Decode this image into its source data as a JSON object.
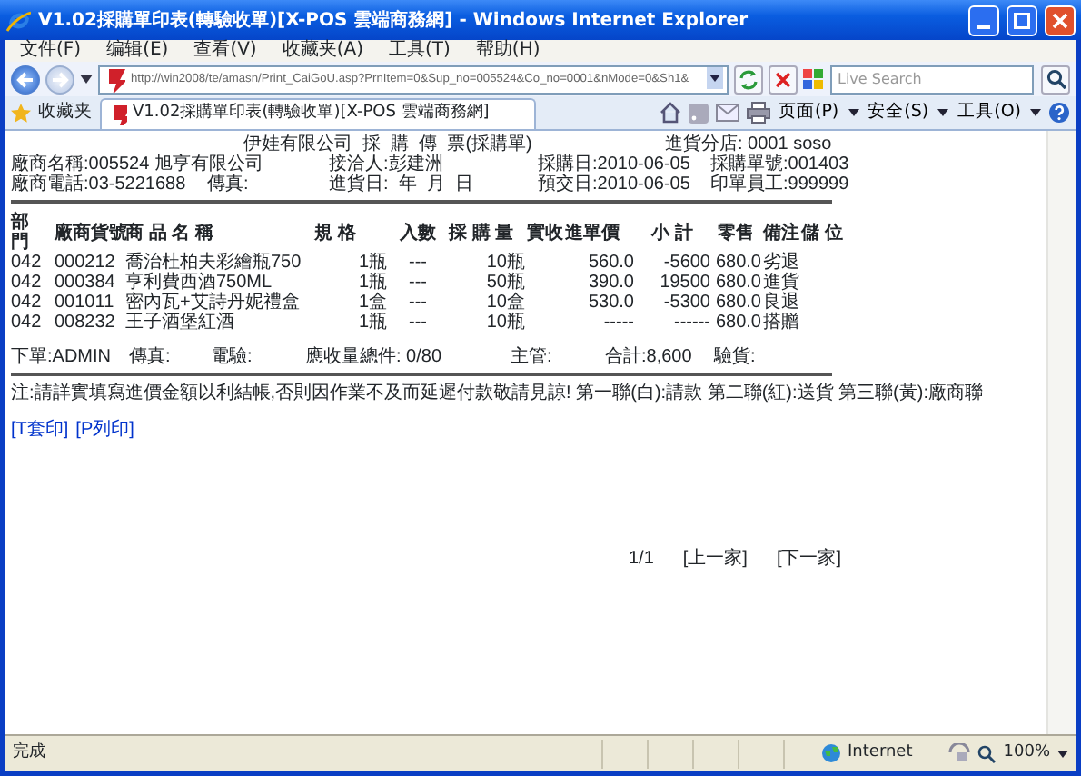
{
  "window": {
    "title": "V1.02採購單印表(轉驗收單)[X-POS 雲端商務網] - Windows Internet Explorer"
  },
  "menu": [
    "文件(F)",
    "编辑(E)",
    "查看(V)",
    "收藏夹(A)",
    "工具(T)",
    "帮助(H)"
  ],
  "address": {
    "url": "http://win2008/te/amasn/Print_CaiGoU.asp?PrnItem=0&Sup_no=005524&Co_no=0001&nMode=0&Sh1&"
  },
  "search": {
    "placeholder": "Live Search"
  },
  "favorites": "收藏夹",
  "tabs": [
    {
      "label": "V1.02採購單印表(轉驗收單)[X-POS 雲端商務網]",
      "selected": true
    }
  ],
  "command_bar": [
    "页面(P)",
    "安全(S)",
    "工具(O)"
  ],
  "document": {
    "heading": "伊娃有限公司  採  購  傳  票(採購單)",
    "branch": "進貨分店: 0001 soso",
    "info_rows": [
      [
        "廠商名稱:005524 旭亨有限公司",
        "接洽人:彭建洲",
        "採購日:2010-06-05",
        "採購單號:001403"
      ],
      [
        "廠商電話:03-5221688",
        "傳真:",
        "進貨日:  年  月  日",
        "預交日:2010-06-05",
        "印單員工:999999"
      ]
    ],
    "columns": [
      "部門",
      "廠商貨號",
      "商 品 名 稱",
      "規 格",
      "入數",
      "採 購 量",
      "實收",
      "進單價",
      "小 計",
      "零售",
      "備注",
      "儲 位"
    ],
    "rows": [
      [
        "042",
        "000212",
        "喬治杜柏夫彩繪瓶750",
        "1瓶",
        "---",
        "10瓶",
        "",
        "560.0",
        "-5600",
        "680.0",
        "劣退",
        ""
      ],
      [
        "042",
        "000384",
        "亨利費西酒750ML",
        "1瓶",
        "---",
        "50瓶",
        "",
        "390.0",
        "19500",
        "680.0",
        "進貨",
        ""
      ],
      [
        "042",
        "001011",
        "密內瓦+艾詩丹妮禮盒",
        "1盒",
        "---",
        "10盒",
        "",
        "530.0",
        "-5300",
        "680.0",
        "良退",
        ""
      ],
      [
        "042",
        "008232",
        "王子酒堡紅酒",
        "1瓶",
        "---",
        "10瓶",
        "",
        "-----",
        "------",
        "680.0",
        "搭贈",
        ""
      ]
    ],
    "signoffs": [
      "下單:ADMIN",
      "傳真:",
      "電驗:",
      "應收量總件: 0/80",
      "主管:",
      "合計:8,600",
      "驗貨:"
    ],
    "note": "注:請詳實填寫進價金額以利結帳,否則因作業不及而延遲付款敬請見諒! 第一聯(白):請款 第二聯(紅):送貨 第三聯(黃):廠商聯",
    "print_links": [
      "[T套印]",
      "[P列印]"
    ],
    "pager": {
      "position": "1/1",
      "links": [
        "[上一家]",
        "[下一家]"
      ]
    }
  },
  "status_bar": {
    "text": "完成",
    "zone": "Internet",
    "zoom": "100%"
  }
}
